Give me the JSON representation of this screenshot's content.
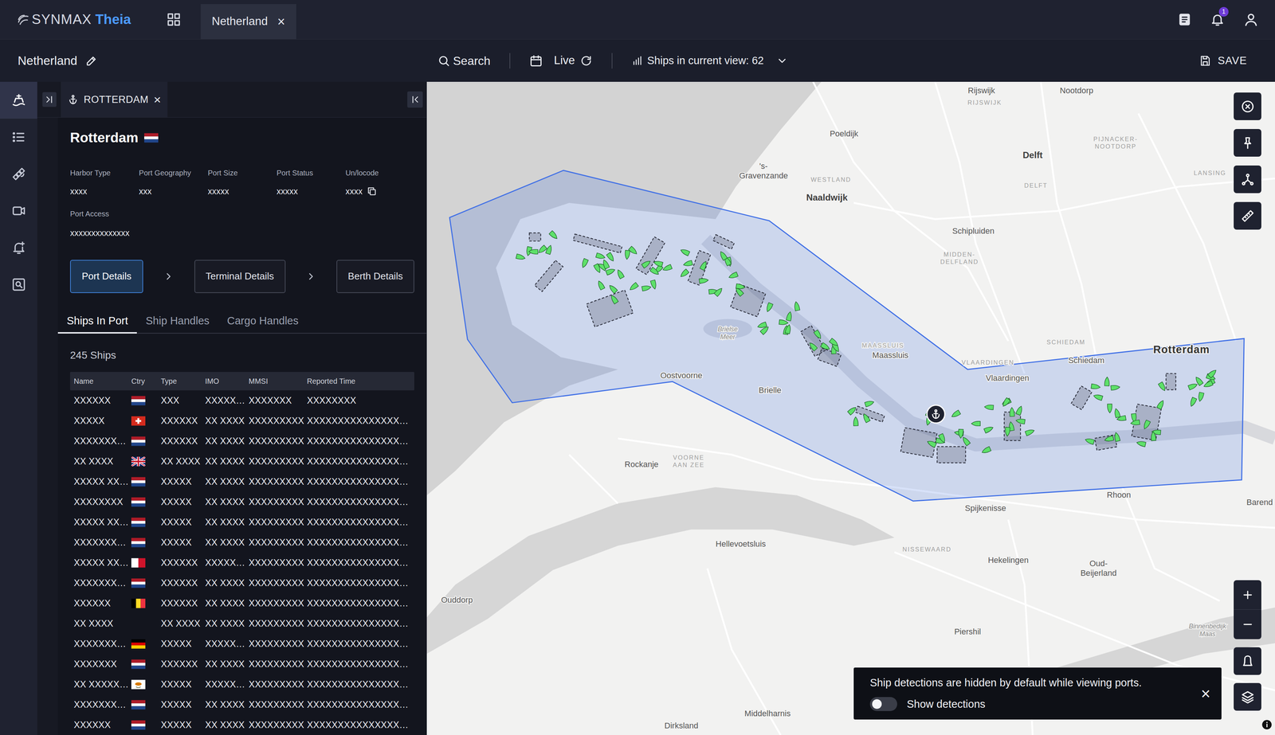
{
  "app": {
    "brand_prefix": "SYNMAX",
    "brand_name": "Theia",
    "notification_count": "1"
  },
  "tabs": [
    {
      "label": "Netherland",
      "close": "×",
      "selected": true
    }
  ],
  "toolbar": {
    "title": "Netherland",
    "search": "Search",
    "mode": "Live",
    "ships_in_view": "Ships in current view: 62",
    "save": "SAVE"
  },
  "sidebar": {
    "items": [
      {
        "selected": true
      },
      {
        "selected": false
      },
      {
        "selected": false
      },
      {
        "selected": false
      },
      {
        "selected": false
      },
      {
        "selected": false
      }
    ]
  },
  "panel": {
    "tab": {
      "label": "ROTTERDAM",
      "close": "×"
    },
    "port": {
      "name": "Rotterdam",
      "flag": "nl"
    },
    "fields": [
      {
        "label": "Harbor Type",
        "value": "xxxx",
        "copyable": false
      },
      {
        "label": "Port Geography",
        "value": "xxx",
        "copyable": false
      },
      {
        "label": "Port Size",
        "value": "xxxxx",
        "copyable": false
      },
      {
        "label": "Port Status",
        "value": "xxxxx",
        "copyable": false
      },
      {
        "label": "Un/locode",
        "value": "xxxx",
        "copyable": true
      }
    ],
    "access": {
      "label": "Port Access",
      "value": "xxxxxxxxxxxxxx"
    },
    "steps": [
      {
        "label": "Port Details",
        "selected": true
      },
      {
        "label": "Terminal Details",
        "selected": false
      },
      {
        "label": "Berth Details",
        "selected": false
      }
    ],
    "subtabs": [
      {
        "label": "Ships In Port",
        "selected": true
      },
      {
        "label": "Ship Handles",
        "selected": false
      },
      {
        "label": "Cargo Handles",
        "selected": false
      }
    ],
    "count": "245 Ships",
    "table": {
      "columns": [
        "Name",
        "Ctry",
        "Type",
        "IMO",
        "MMSI",
        "Reported Time"
      ],
      "rows": [
        {
          "name": "XXXXXX",
          "flag": "nl",
          "type": "XXX",
          "imo": "XXXXX…",
          "mmsi": "XXXXXXX",
          "reported": "XXXXXXXX"
        },
        {
          "name": "XXXXX",
          "flag": "ch",
          "type": "XXXXXX",
          "imo": "XX XXXX",
          "mmsi": "XXXXXXXXX",
          "reported": "XXXXXXXXXXXXXXX…"
        },
        {
          "name": "XXXXXXX…",
          "flag": "nl",
          "type": "XXXXXX",
          "imo": "XX XXXX",
          "mmsi": "XXXXXXXXX",
          "reported": "XXXXXXXXXXXXXXX…"
        },
        {
          "name": "XX XXXX",
          "flag": "gb",
          "type": "XX XXXX",
          "imo": "XX XXXX",
          "mmsi": "XXXXXXXXX",
          "reported": "XXXXXXXXXXXXXXX…"
        },
        {
          "name": "XXXXX XX…",
          "flag": "nl",
          "type": "XXXXX",
          "imo": "XX XXXX",
          "mmsi": "XXXXXXXXX",
          "reported": "XXXXXXXXXXXXXXX…"
        },
        {
          "name": "XXXXXXXX",
          "flag": "nl",
          "type": "XXXXX",
          "imo": "XX XXXX",
          "mmsi": "XXXXXXXXX",
          "reported": "XXXXXXXXXXXXXXX…"
        },
        {
          "name": "XXXXX XX…",
          "flag": "nl",
          "type": "XXXXX",
          "imo": "XX XXXX",
          "mmsi": "XXXXXXXXX",
          "reported": "XXXXXXXXXXXXXXX…"
        },
        {
          "name": "XXXXXXX…",
          "flag": "nl",
          "type": "XXXXX",
          "imo": "XX XXXX",
          "mmsi": "XXXXXXXXX",
          "reported": "XXXXXXXXXXXXXXX…"
        },
        {
          "name": "XXXXX XX…",
          "flag": "mt",
          "type": "XXXXXX",
          "imo": "XXXXX…",
          "mmsi": "XXXXXXXXX",
          "reported": "XXXXXXXXXXXXXXX…"
        },
        {
          "name": "XXXXXXX…",
          "flag": "nl",
          "type": "XXXXXX",
          "imo": "XX XXXX",
          "mmsi": "XXXXXXXXX",
          "reported": "XXXXXXXXXXXXXXX…"
        },
        {
          "name": "XXXXXX",
          "flag": "be",
          "type": "XXXXXX",
          "imo": "XX XXXX",
          "mmsi": "XXXXXXXXX",
          "reported": "XXXXXXXXXXXXXXX…"
        },
        {
          "name": "XX XXXX",
          "flag": "none",
          "type": "XX XXXX",
          "imo": "XX XXXX",
          "mmsi": "XXXXXXXXX",
          "reported": "XXXXXXXXXXXXXXX…"
        },
        {
          "name": "XXXXXXX…",
          "flag": "de",
          "type": "XXXXX",
          "imo": "XXXXX…",
          "mmsi": "XXXXXXXXX",
          "reported": "XXXXXXXXXXXXXXX…"
        },
        {
          "name": "XXXXXXX",
          "flag": "nl",
          "type": "XXXXXX",
          "imo": "XX XXXX",
          "mmsi": "XXXXXXXXX",
          "reported": "XXXXXXXXXXXXXXX…"
        },
        {
          "name": "XX XXXXX…",
          "flag": "cy",
          "type": "XXXXX",
          "imo": "XXXXX…",
          "mmsi": "XXXXXXXXX",
          "reported": "XXXXXXXXXXXXXXX…"
        },
        {
          "name": "XXXXXXX…",
          "flag": "nl",
          "type": "XXXXX",
          "imo": "XX XXXX",
          "mmsi": "XXXXXXXXX",
          "reported": "XXXXXXXXXXXXXXX…"
        },
        {
          "name": "XXXXXX",
          "flag": "nl",
          "type": "XXXXX",
          "imo": "XX XXXX",
          "mmsi": "XXXXXXXXX",
          "reported": "XXXXXXXXXXXXXXX…"
        }
      ]
    }
  },
  "map": {
    "labels": [
      {
        "lines": [
          "Rijswijk"
        ],
        "kind": "town"
      },
      {
        "lines": [
          "RIJSWIJK"
        ],
        "kind": "district"
      },
      {
        "lines": [
          "Nootdorp"
        ],
        "kind": "town"
      },
      {
        "lines": [
          "Poeldijk"
        ],
        "kind": "town"
      },
      {
        "lines": [
          "Delft"
        ],
        "kind": "major"
      },
      {
        "lines": [
          "PIJNACKER-",
          "NOOTDORP"
        ],
        "kind": "district"
      },
      {
        "lines": [
          "LANSING"
        ],
        "kind": "district"
      },
      {
        "lines": [
          "'s-",
          "Gravenzande"
        ],
        "kind": "town"
      },
      {
        "lines": [
          "WESTLAND"
        ],
        "kind": "district"
      },
      {
        "lines": [
          "Naaldwijk"
        ],
        "kind": "major"
      },
      {
        "lines": [
          "DELFT"
        ],
        "kind": "district"
      },
      {
        "lines": [
          "Schipluiden"
        ],
        "kind": "town"
      },
      {
        "lines": [
          "MIDDEN-",
          "DELFLAND"
        ],
        "kind": "district"
      },
      {
        "lines": [
          "SCHIEDAM"
        ],
        "kind": "district"
      },
      {
        "lines": [
          "VLAARDINGEN"
        ],
        "kind": "district"
      },
      {
        "lines": [
          "MAASSLUIS"
        ],
        "kind": "district"
      },
      {
        "lines": [
          "Maassluis"
        ],
        "kind": "town"
      },
      {
        "lines": [
          "Schiedam"
        ],
        "kind": "town"
      },
      {
        "lines": [
          "Rotterdam"
        ],
        "kind": "city"
      },
      {
        "lines": [
          "Vlaardingen"
        ],
        "kind": "town"
      },
      {
        "lines": [
          "Brielse",
          "Meer"
        ],
        "kind": "water"
      },
      {
        "lines": [
          "Oostvoorne"
        ],
        "kind": "town"
      },
      {
        "lines": [
          "Brielle"
        ],
        "kind": "town"
      },
      {
        "lines": [
          "Rockanje"
        ],
        "kind": "town"
      },
      {
        "lines": [
          "VOORNE",
          "AAN ZEE"
        ],
        "kind": "district"
      },
      {
        "lines": [
          "Spijkenisse"
        ],
        "kind": "town"
      },
      {
        "lines": [
          "Rhoon"
        ],
        "kind": "town"
      },
      {
        "lines": [
          "Barend"
        ],
        "kind": "town"
      },
      {
        "lines": [
          "Hellevoetsluis"
        ],
        "kind": "town"
      },
      {
        "lines": [
          "NISSEWAARD"
        ],
        "kind": "district"
      },
      {
        "lines": [
          "Hekelingen"
        ],
        "kind": "town"
      },
      {
        "lines": [
          "Oud-",
          "Beijerland"
        ],
        "kind": "town"
      },
      {
        "lines": [
          "Ouddorp"
        ],
        "kind": "town"
      },
      {
        "lines": [
          "Piershil"
        ],
        "kind": "town"
      },
      {
        "lines": [
          "Binnenbedijk",
          "Maas"
        ],
        "kind": "water"
      },
      {
        "lines": [
          "Middelharnis"
        ],
        "kind": "town"
      },
      {
        "lines": [
          "Dirksland"
        ],
        "kind": "town"
      }
    ],
    "toast": {
      "message": "Ship detections are hidden by default while viewing ports.",
      "toggle_label": "Show detections",
      "on": false,
      "close": "×"
    }
  }
}
